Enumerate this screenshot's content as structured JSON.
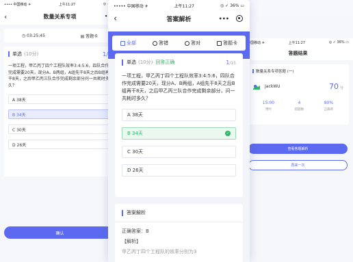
{
  "left": {
    "status": {
      "carrier": "•••• 中国移动 ✈",
      "time": "上午11:27",
      "right": "◎ ✓ 39"
    },
    "title": "数量关系专项",
    "more": "•••·",
    "timer": "03:25:45",
    "card_label": "答题卡",
    "question": {
      "type": "单选",
      "score": "(10分)",
      "number": "1/1"
    },
    "question_text": "一项工程，甲乙丙丁四个工程队效率3:4:5:6，四队合作完成需要20天，现分A、B两组，A组先干8天之后B组再干8天，之后甲乙丙三队合作完成剩余部分问一共耗时多久？",
    "options": [
      "A  38天",
      "B  34天",
      "C  30天",
      "D  26天"
    ],
    "confirm": "确认"
  },
  "center": {
    "status": {
      "carrier": "••••• 中国移动 ✈",
      "time": "上午11:27",
      "right": "◎ ✓ 36% ▭"
    },
    "title": "答案解析",
    "more": "•••",
    "filters": [
      "全部",
      "答错",
      "答对",
      "答题卡"
    ],
    "question": {
      "type": "单选",
      "score": "(10分)",
      "status": "回答正确",
      "current": "1",
      "total": "/15"
    },
    "question_text": "一项工程，甲乙丙丁四个工程队效率3:4:5:6，四队合作完成需要20天，现分A、B两组，A组先干8天之后B组再干8天，之后甲乙丙三队合作完成剩余部分，问一共耗时多久？",
    "options": [
      "A  38天",
      "B  34天",
      "C  30天",
      "D  26天"
    ],
    "analysis_title": "答案解析",
    "answer": "正确答案：B",
    "analysis_label": "【解析】",
    "analysis_line": "甲乙丙丁四个工程队的效率分别为3"
  },
  "right": {
    "status": {
      "carrier": "中国移动 ✈",
      "time": "上午11:27",
      "right": "◎ ✓ 36% ▭"
    },
    "title": "答题结果",
    "exam_name": "数量关系专项答题 (一)",
    "user": "JackWU",
    "score": "70",
    "score_unit": "分",
    "stats": [
      {
        "value": "15:00",
        "label": "用时"
      },
      {
        "value": "4",
        "label": "错题数"
      },
      {
        "value": "80%",
        "label": "正确率"
      }
    ],
    "btn_view": "查看答题解析",
    "btn_retry": "再来一次"
  },
  "colors": {
    "accent": "#5b6af0",
    "correct": "#2fb86a"
  }
}
